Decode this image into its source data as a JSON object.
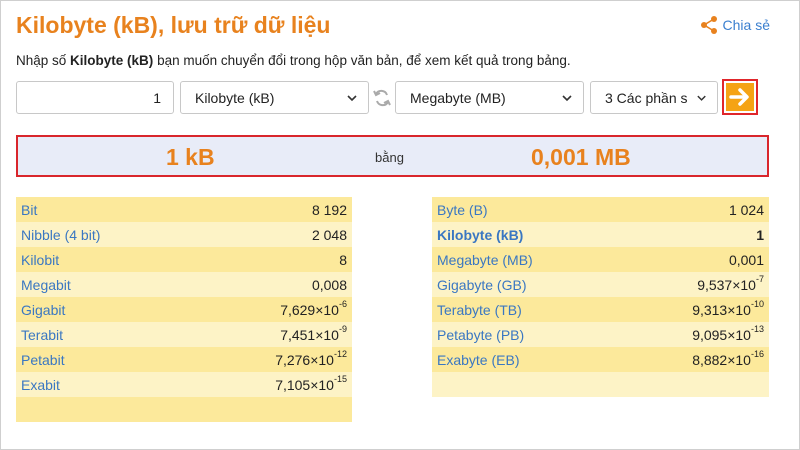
{
  "header": {
    "title": "Kilobyte (kB), lưu trữ dữ liệu",
    "share_label": "Chia sẻ",
    "intro_before": "Nhập số ",
    "intro_bold": "Kilobyte (kB)",
    "intro_after": " bạn muốn chuyển đổi trong hộp văn bản, để xem kết quả trong bảng."
  },
  "controls": {
    "input_value": "1",
    "from_unit": "Kilobyte (kB)",
    "to_unit": "Megabyte (MB)",
    "decimals": "3 Các phần s",
    "go_icon": "arrow-right-icon",
    "swap_icon": "swap-icon"
  },
  "result": {
    "left": "1 kB",
    "middle": "bằng",
    "right": "0,001 MB"
  },
  "left_table": [
    {
      "label": "Bit",
      "value": "8 192"
    },
    {
      "label": "Nibble (4 bit)",
      "value": "2 048"
    },
    {
      "label": "Kilobit",
      "value": "8"
    },
    {
      "label": "Megabit",
      "value": "0,008"
    },
    {
      "label": "Gigabit",
      "mantissa": "7,629×10",
      "exp": "-6"
    },
    {
      "label": "Terabit",
      "mantissa": "7,451×10",
      "exp": "-9"
    },
    {
      "label": "Petabit",
      "mantissa": "7,276×10",
      "exp": "-12"
    },
    {
      "label": "Exabit",
      "mantissa": "7,105×10",
      "exp": "-15"
    },
    {
      "label": "",
      "value": ""
    }
  ],
  "right_table": [
    {
      "label": "Byte (B)",
      "value": "1 024"
    },
    {
      "label": "Kilobyte (kB)",
      "value": "1",
      "highlight": true
    },
    {
      "label": "Megabyte (MB)",
      "value": "0,001"
    },
    {
      "label": "Gigabyte (GB)",
      "mantissa": "9,537×10",
      "exp": "-7"
    },
    {
      "label": "Terabyte (TB)",
      "mantissa": "9,313×10",
      "exp": "-10"
    },
    {
      "label": "Petabyte (PB)",
      "mantissa": "9,095×10",
      "exp": "-13"
    },
    {
      "label": "Exabyte (EB)",
      "mantissa": "8,882×10",
      "exp": "-16"
    },
    {
      "label": "",
      "value": ""
    }
  ],
  "colors": {
    "accent": "#e8821e",
    "link": "#3a77c2",
    "border_red": "#d9262c",
    "row_dark": "#fce99b",
    "row_light": "#fdf3c6"
  }
}
